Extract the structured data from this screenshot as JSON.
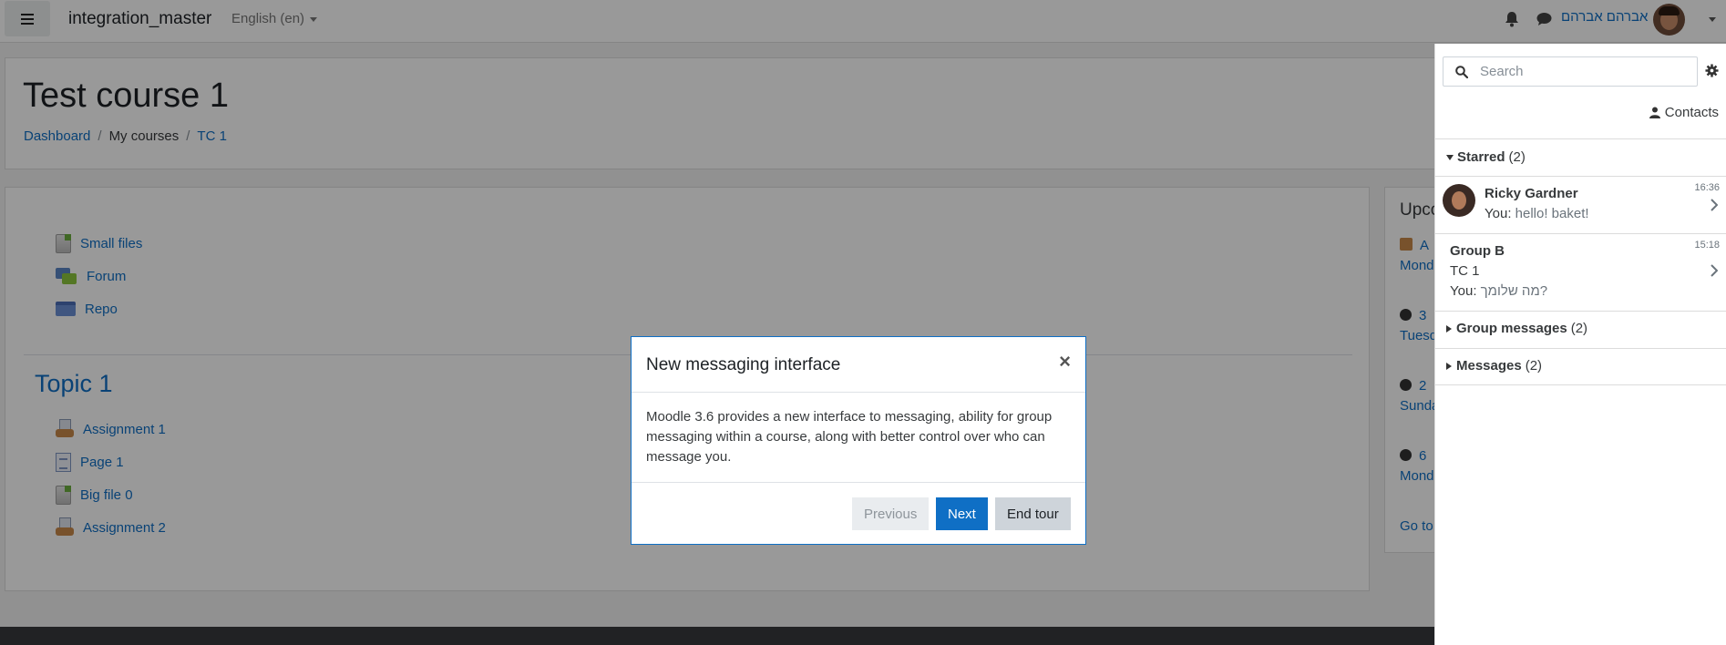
{
  "navbar": {
    "site_name": "integration_master",
    "language": "English (en)",
    "user_name": "אברהם אברהם",
    "icons": [
      "menu-icon",
      "bell-icon",
      "chat-icon",
      "avatar",
      "chevron-down-icon"
    ]
  },
  "header": {
    "title": "Test course 1",
    "breadcrumb": [
      {
        "label": "Dashboard",
        "link": true
      },
      {
        "label": "My courses",
        "link": false
      },
      {
        "label": "TC 1",
        "link": true
      }
    ]
  },
  "course": {
    "section0": [
      {
        "label": "Small files",
        "icon": "file-icon"
      },
      {
        "label": "Forum",
        "icon": "forum-icon"
      },
      {
        "label": "Repo",
        "icon": "folder-icon"
      }
    ],
    "topic1_title": "Topic 1",
    "topic1": [
      {
        "label": "Assignment 1",
        "icon": "assignment-icon"
      },
      {
        "label": "Page 1",
        "icon": "page-icon"
      },
      {
        "label": "Big file 0",
        "icon": "file-icon"
      },
      {
        "label": "Assignment 2",
        "icon": "assignment-icon"
      }
    ]
  },
  "upcoming": {
    "title": "Upco",
    "events": [
      {
        "name": "A",
        "date": "Mond"
      },
      {
        "name": "3",
        "date": "Tuesd"
      },
      {
        "name": "2",
        "date": "Sunda"
      },
      {
        "name": "6",
        "date": "Mond"
      }
    ],
    "goto": "Go to"
  },
  "drawer": {
    "search_placeholder": "Search",
    "contacts_label": "Contacts",
    "starred": {
      "label": "Starred",
      "count": "(2)"
    },
    "conversations": [
      {
        "name": "Ricky Gardner",
        "time": "16:36",
        "prefix": "You:",
        "message": "hello! baket!"
      },
      {
        "name": "Group B",
        "subtitle": "TC 1",
        "time": "15:18",
        "prefix": "You:",
        "message": "מה שלומך?"
      }
    ],
    "group_messages": {
      "label": "Group messages",
      "count": "(2)"
    },
    "messages": {
      "label": "Messages",
      "count": "(2)"
    }
  },
  "tour": {
    "title": "New messaging interface",
    "close": "×",
    "body": "Moodle 3.6 provides a new interface to messaging, ability for group messaging within a course, along with better control over who can message you.",
    "previous": "Previous",
    "next": "Next",
    "end": "End tour"
  },
  "colors": {
    "link": "#0f6fc5",
    "primary_button": "#0f6fc5",
    "overlay": "rgba(0,0,0,0.4)"
  }
}
